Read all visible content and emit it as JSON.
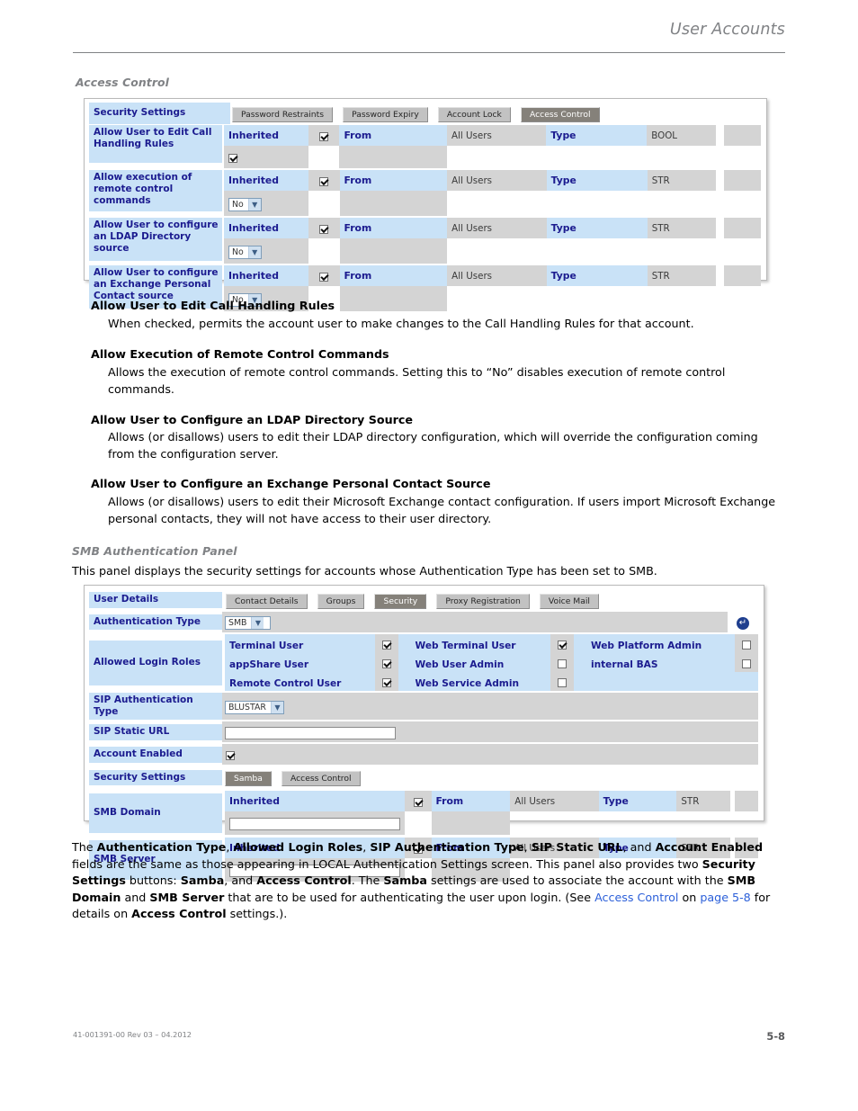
{
  "header": {
    "title": "User Accounts"
  },
  "sections": {
    "access_control_heading": "Access Control",
    "smb_heading": "SMB Authentication Panel",
    "smb_intro": "This panel displays the security settings for accounts whose Authentication Type has been set to SMB."
  },
  "panel1": {
    "security_settings_label": "Security Settings",
    "tabs": [
      {
        "label": "Password Restraints",
        "selected": false
      },
      {
        "label": "Password Expiry",
        "selected": false
      },
      {
        "label": "Account Lock",
        "selected": false
      },
      {
        "label": "Access Control",
        "selected": true
      }
    ],
    "rows": [
      {
        "label": "Allow User to Edit Call Handling Rules",
        "inherited_label": "Inherited",
        "inherited_checked": true,
        "from_label": "From",
        "from_value": "All Users",
        "type_label": "Type",
        "type_value": "BOOL",
        "control": "checkbox",
        "control_checked": true,
        "control_value": ""
      },
      {
        "label": "Allow execution of remote control commands",
        "inherited_label": "Inherited",
        "inherited_checked": true,
        "from_label": "From",
        "from_value": "All Users",
        "type_label": "Type",
        "type_value": "STR",
        "control": "select",
        "control_checked": false,
        "control_value": "No"
      },
      {
        "label": "Allow User to configure an LDAP Directory source",
        "inherited_label": "Inherited",
        "inherited_checked": true,
        "from_label": "From",
        "from_value": "All Users",
        "type_label": "Type",
        "type_value": "STR",
        "control": "select",
        "control_checked": false,
        "control_value": "No"
      },
      {
        "label": "Allow User to configure an Exchange Personal Contact source",
        "inherited_label": "Inherited",
        "inherited_checked": true,
        "from_label": "From",
        "from_value": "All Users",
        "type_label": "Type",
        "type_value": "STR",
        "control": "select",
        "control_checked": false,
        "control_value": "No"
      }
    ]
  },
  "definitions": [
    {
      "term": "Allow User to Edit Call Handling Rules",
      "def": "When checked, permits the account user to make changes to the Call Handling Rules for that account."
    },
    {
      "term": "Allow Execution of Remote Control Commands",
      "def": "Allows the execution of remote control commands. Setting this to “No” disables execution of remote control commands."
    },
    {
      "term": "Allow User to Configure an LDAP Directory Source",
      "def": "Allows (or disallows) users to edit their LDAP directory configuration, which will override the configuration coming from the configuration server."
    },
    {
      "term": "Allow User to Configure an Exchange Personal Contact Source",
      "def": "Allows (or disallows) users to edit their Microsoft Exchange contact configuration. If users import Microsoft Exchange personal contacts, they will not have access to their user directory."
    }
  ],
  "panel2": {
    "user_details_label": "User Details",
    "tabs": [
      {
        "label": "Contact Details",
        "selected": false
      },
      {
        "label": "Groups",
        "selected": false
      },
      {
        "label": "Security",
        "selected": true
      },
      {
        "label": "Proxy Registration",
        "selected": false
      },
      {
        "label": "Voice Mail",
        "selected": false
      }
    ],
    "auth_type_label": "Authentication Type",
    "auth_type_value": "SMB",
    "return_icon": "return-arrow-icon",
    "allowed_login_roles_label": "Allowed Login Roles",
    "roles": [
      {
        "name": "Terminal User",
        "checked": true
      },
      {
        "name": "Web Terminal User",
        "checked": true
      },
      {
        "name": "Web Platform Admin",
        "checked": false
      },
      {
        "name": "appShare User",
        "checked": true
      },
      {
        "name": "Web User Admin",
        "checked": false
      },
      {
        "name": "internal BAS",
        "checked": false
      },
      {
        "name": "Remote Control User",
        "checked": true
      },
      {
        "name": "Web Service Admin",
        "checked": false
      },
      {
        "name": "",
        "checked": null
      }
    ],
    "sip_auth_type_label": "SIP Authentication Type",
    "sip_auth_type_value": "BLUSTAR",
    "sip_static_url_label": "SIP Static URL",
    "sip_static_url_value": "",
    "account_enabled_label": "Account Enabled",
    "account_enabled_checked": true,
    "security_settings_label": "Security Settings",
    "security_buttons": [
      {
        "label": "Samba",
        "selected": true
      },
      {
        "label": "Access Control",
        "selected": false
      }
    ],
    "smb_rows": [
      {
        "label": "SMB Domain",
        "inherited_label": "Inherited",
        "inherited_checked": true,
        "from_label": "From",
        "from_value": "All Users",
        "type_label": "Type",
        "type_value": "STR",
        "input_value": ""
      },
      {
        "label": "SMB Server",
        "inherited_label": "Inherited",
        "inherited_checked": true,
        "from_label": "From",
        "from_value": "All Users",
        "type_label": "Type",
        "type_value": "STR",
        "input_value": ""
      }
    ]
  },
  "closing_paragraph": {
    "line1_a": "The ",
    "b1": "Authentication Type",
    "line1_b": ", ",
    "b2": "Allowed Login Roles",
    "line1_c": ", ",
    "b3": "SIP Authentication Type",
    "line1_d": ", ",
    "b4": "SIP Static URL",
    "line1_e": ", and ",
    "b5": "Account Enabled",
    "line1_f": " fields are the same as those appearing in LOCAL Authentication Settings screen. This panel also provides two ",
    "b6": "Security Settings",
    "line2_a": " buttons: ",
    "b7": "Samba",
    "line2_b": ", and ",
    "b8": "Access Control",
    "line2_c": ". The ",
    "b9": "Samba",
    "line2_d": " settings are used to associate the account with the ",
    "b10": "SMB Domain",
    "line2_e": " and ",
    "b11": "SMB Server",
    "line2_f": " that are to be used for authenticating the user upon login. (See ",
    "link1": "Access Control",
    "line3_a": " on ",
    "link2": "page 5-8",
    "line3_b": " for details on ",
    "b12": "Access Control",
    "line3_c": " settings.)."
  },
  "footer": {
    "doc_id": "41-001391-00 Rev 03 – 04.2012",
    "page_number": "5-8"
  }
}
